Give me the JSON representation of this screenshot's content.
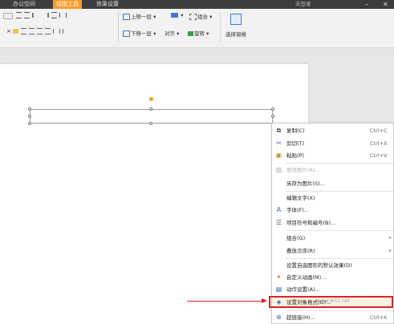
{
  "tabs": [
    "办公空间",
    "绘图工具",
    "效果设置"
  ],
  "window": {
    "login": "未登录",
    "minimize": "–",
    "close": "✕"
  },
  "ribbon": {
    "row1": [
      "上移一层",
      "组合",
      "选择窗格"
    ],
    "row2": [
      "下移一层",
      "对齐",
      "旋转"
    ]
  },
  "menu": {
    "items": [
      {
        "label": "复制(C)",
        "shortcut": "Ctrl+C",
        "icon": "copy-icon",
        "glyph": "⧉"
      },
      {
        "label": "剪切(T)",
        "shortcut": "Ctrl+X",
        "icon": "scissors-icon",
        "glyph": "✂"
      },
      {
        "label": "粘贴(P)",
        "shortcut": "Ctrl+V",
        "icon": "paste-icon",
        "glyph": "▣"
      },
      {
        "label": "更改图片(A)...",
        "shortcut": "",
        "icon": "picture-icon",
        "glyph": "▨",
        "disabled": true
      },
      {
        "label": "另存为图片(S)...",
        "shortcut": "",
        "icon": "",
        "glyph": ""
      },
      {
        "label": "编辑文字(X)",
        "shortcut": "",
        "icon": "",
        "glyph": ""
      },
      {
        "label": "字体(F)...",
        "shortcut": "",
        "icon": "font-icon",
        "glyph": "A"
      },
      {
        "label": "项目符号和编号(B)...",
        "shortcut": "",
        "icon": "bullet-list-icon",
        "glyph": "☰"
      },
      {
        "label": "组合(G)",
        "shortcut": "",
        "icon": "",
        "glyph": "",
        "submenu": true
      },
      {
        "label": "叠放次序(R)",
        "shortcut": "",
        "icon": "",
        "glyph": "",
        "submenu": true
      },
      {
        "label": "设置自选图形的默认效果(D)",
        "shortcut": "",
        "icon": "",
        "glyph": ""
      },
      {
        "label": "自定义动画(M)...",
        "shortcut": "",
        "icon": "animation-icon",
        "glyph": "✦"
      },
      {
        "label": "动作设置(A)...",
        "shortcut": "",
        "icon": "action-icon",
        "glyph": "▤"
      },
      {
        "label": "设置对象格式(O)...",
        "shortcut": "",
        "icon": "format-icon",
        "glyph": "◈",
        "highlighted": true
      },
      {
        "label": "超链接(H)...",
        "shortcut": "Ctrl+K",
        "icon": "hyperlink-icon",
        "glyph": "⊕"
      }
    ]
  },
  "watermark": "www.jb51.net",
  "colors": {
    "accent": "#ff9b28",
    "annotation": "#e0202c"
  }
}
